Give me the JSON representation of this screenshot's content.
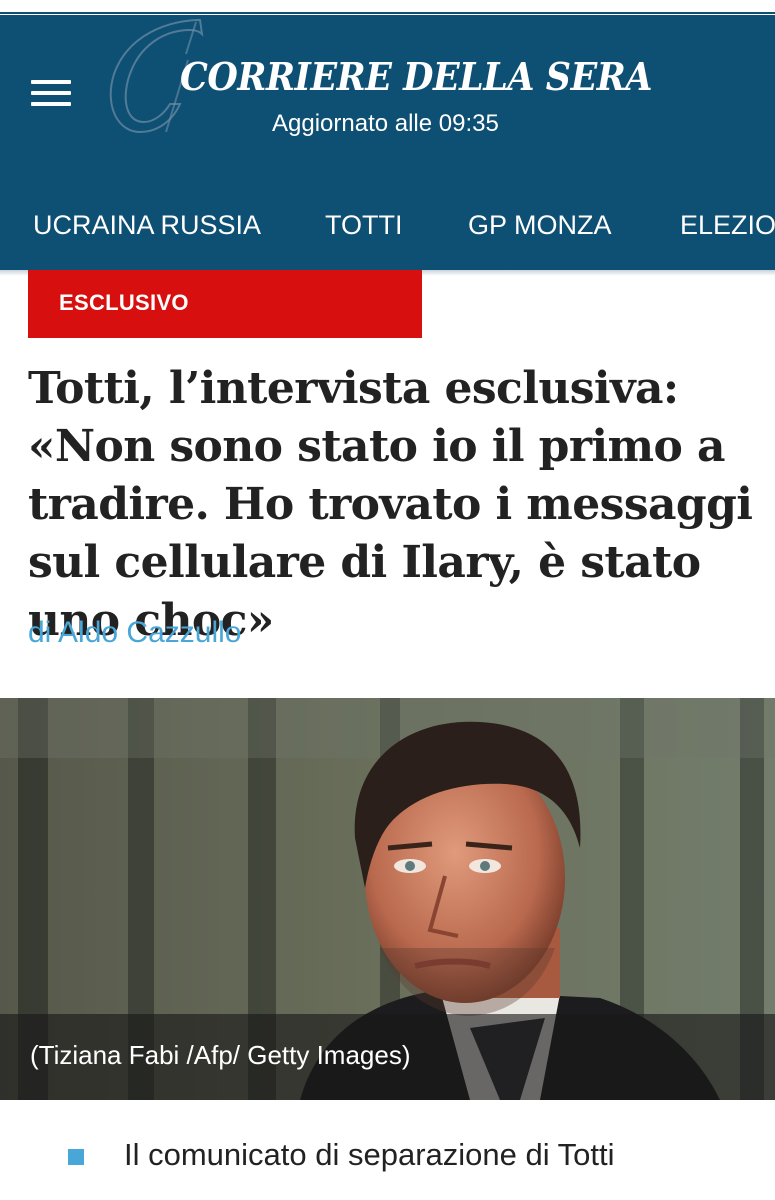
{
  "header": {
    "brand": "CORRIERE DELLA SERA",
    "updated": "Aggiornato alle 09:35",
    "menu_icon": "hamburger-menu-icon",
    "logo_icon": "corriere-c-logo-icon",
    "background_color": "#0e4f74"
  },
  "nav": {
    "items": [
      {
        "label": "UCRAINA RUSSIA"
      },
      {
        "label": "TOTTI"
      },
      {
        "label": "GP MONZA"
      },
      {
        "label": "ELEZIO"
      }
    ]
  },
  "article": {
    "badge": "ESCLUSIVO",
    "badge_color": "#d70f0f",
    "headline": "Totti, l’intervista esclusiva: «Non sono stato io il primo a tradire. Ho trovato i messaggi sul cellulare di Ilary, è stato uno choc»",
    "byline": "di Aldo Cazzullo",
    "byline_color": "#49a7d8",
    "photo_caption": "(Tiziana Fabi /Afp/ Getty Images)"
  },
  "related": {
    "items": [
      {
        "label": "Il comunicato di separazione di Totti"
      }
    ]
  }
}
